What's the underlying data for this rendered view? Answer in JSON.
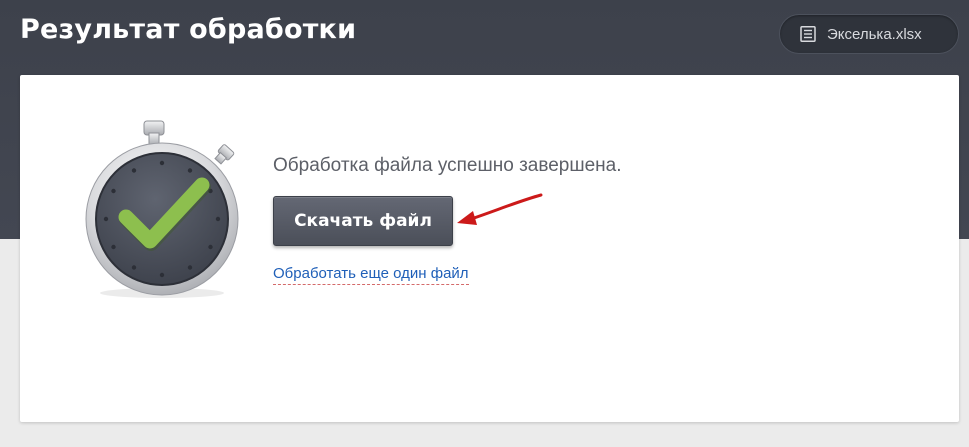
{
  "header": {
    "title": "Результат обработки",
    "file_badge": {
      "icon": "document-icon",
      "label": "Экселька.xlsx"
    }
  },
  "result": {
    "illustration_icon": "stopwatch-check-icon",
    "status_message": "Обработка файла успешно завершена.",
    "download_button_label": "Скачать файл",
    "process_another_link": "Обработать еще один файл"
  },
  "colors": {
    "header_background": "#3d414b",
    "button_background": "#555964",
    "link": "#1f5fb8",
    "check_mark": "#8dbf4e",
    "annotation_arrow": "#cc1a1a"
  }
}
